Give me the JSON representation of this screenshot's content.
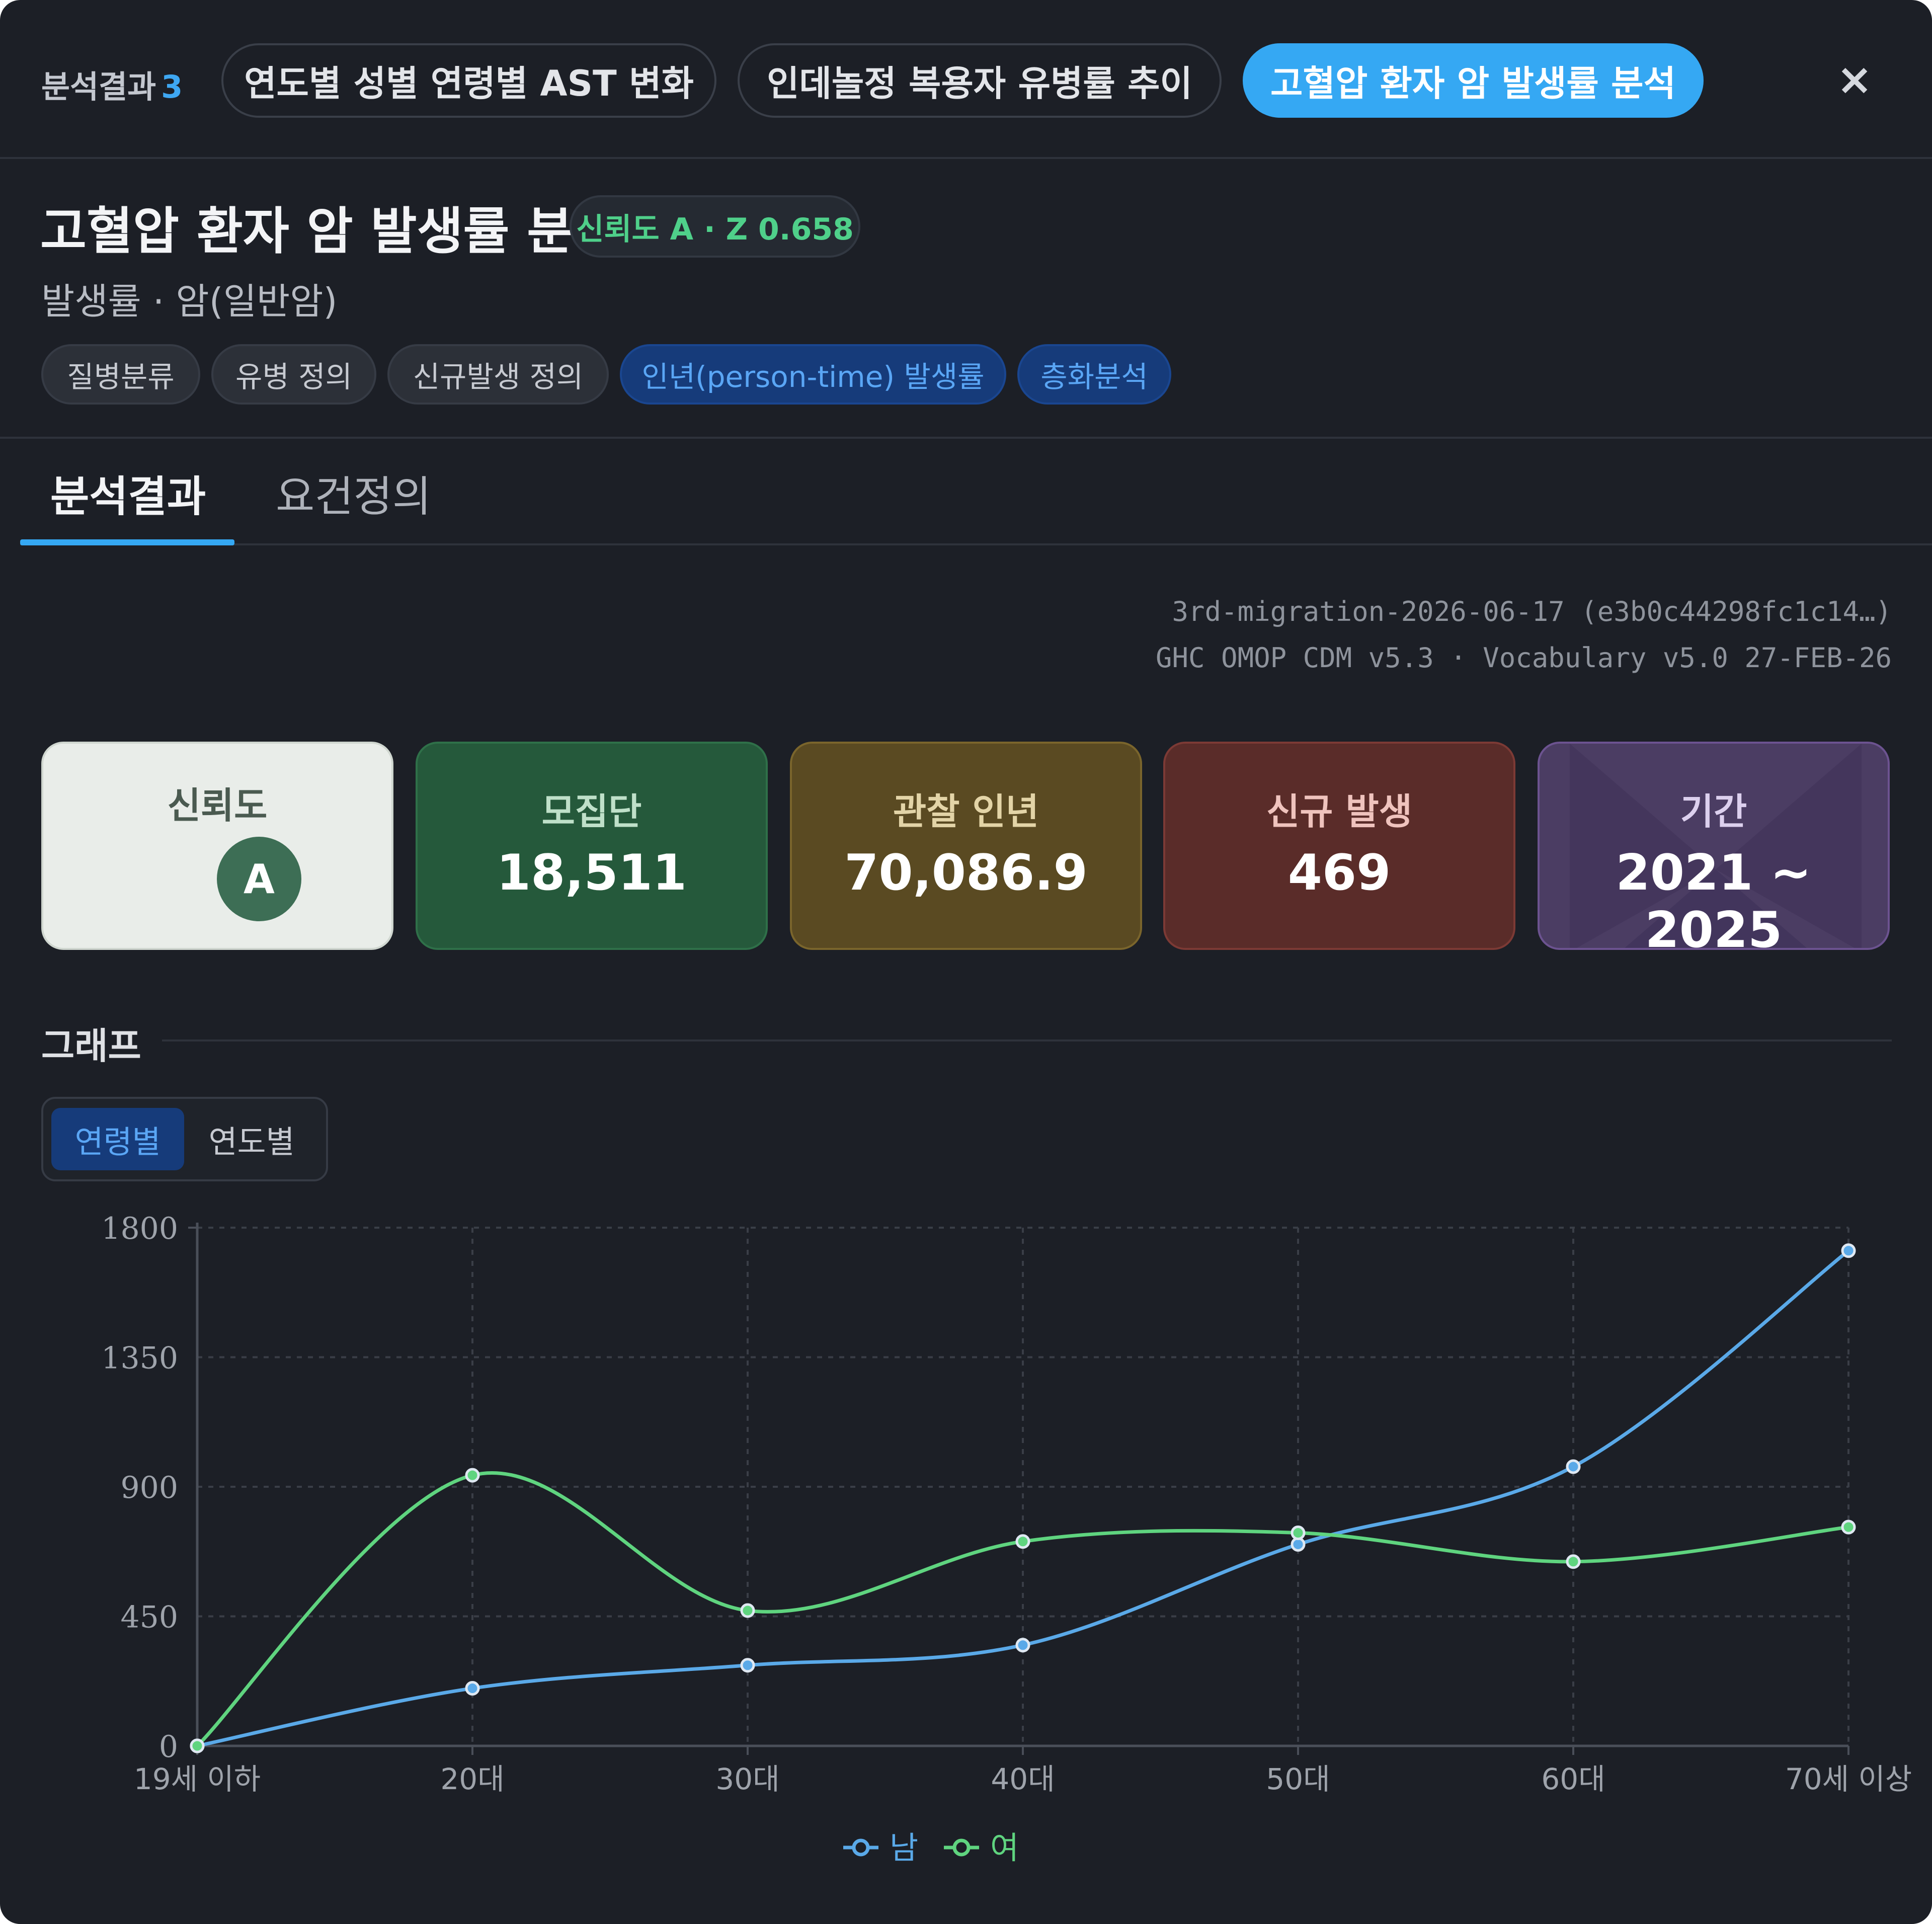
{
  "top_tabs": {
    "count_label": "분석결과",
    "count": "3",
    "tabs": [
      {
        "label": "연도별 성별 연령별 AST 변화",
        "active": false
      },
      {
        "label": "인데놀정 복용자 유병률 추이",
        "active": false
      },
      {
        "label": "고혈압 환자 암 발생률 분석",
        "active": true
      }
    ],
    "close_symbol": "×"
  },
  "header": {
    "title": "고혈압 환자 암 발생률 분석",
    "reliability_badge": "신뢰도 A · Z 0.658",
    "subtitle": "발생률 · 암(일반암)",
    "chips": [
      {
        "label": "질병분류",
        "active": false
      },
      {
        "label": "유병 정의",
        "active": false
      },
      {
        "label": "신규발생 정의",
        "active": false
      },
      {
        "label": "인년(person-time) 발생률",
        "active": true
      },
      {
        "label": "층화분석",
        "active": true
      }
    ]
  },
  "content_tabs": [
    {
      "label": "분석결과",
      "active": true
    },
    {
      "label": "요건정의",
      "active": false
    }
  ],
  "meta": {
    "line1": "3rd-migration-2026-06-17 (e3b0c44298fc1c14…)",
    "line2": "GHC OMOP CDM v5.3 · Vocabulary v5.0 27-FEB-26"
  },
  "stats": {
    "reliability": {
      "label": "신뢰도",
      "grade": "A"
    },
    "population": {
      "label": "모집단",
      "value": "18,511"
    },
    "person_years": {
      "label": "관찰 인년",
      "value": "70,086.9"
    },
    "new_cases": {
      "label": "신규 발생",
      "value": "469"
    },
    "period": {
      "label": "기간",
      "value": "2021 ~ 2025"
    }
  },
  "graph": {
    "title": "그래프",
    "toggle": [
      {
        "label": "연령별",
        "active": true
      },
      {
        "label": "연도별",
        "active": false
      }
    ]
  },
  "colors": {
    "accent": "#35a8f3",
    "male": "#5aa9e8",
    "female": "#5fd47f",
    "background": "#1c1f26"
  },
  "icons": {
    "close": "close-icon",
    "legend": "line-marker-icon"
  },
  "chart_data": {
    "type": "line",
    "categories": [
      "19세 이하",
      "20대",
      "30대",
      "40대",
      "50대",
      "60대",
      "70세 이상"
    ],
    "series": [
      {
        "name": "남",
        "values": [
          0,
          200,
          280,
          350,
          700,
          970,
          1720
        ]
      },
      {
        "name": "여",
        "values": [
          0,
          940,
          470,
          710,
          740,
          640,
          760
        ]
      }
    ],
    "yticks": [
      0,
      450,
      900,
      1350,
      1800
    ],
    "ylim": [
      0,
      1800
    ],
    "grid": true,
    "legend": "bottom-center",
    "smooth": true
  }
}
